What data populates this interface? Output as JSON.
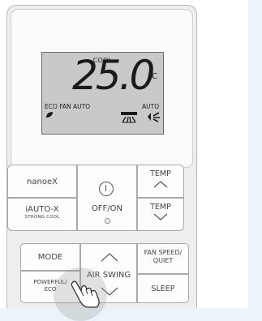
{
  "display": {
    "mode": "COOL",
    "temperature": "25.0",
    "unit": "°C",
    "eco_fan_label": "ECO FAN AUTO",
    "fan_speed_label": "AUTO"
  },
  "buttons": {
    "nanoe": "nanoeX",
    "iauto_line1": "iAUTO-X",
    "iauto_line2": "STRONG COOL",
    "off_on": "OFF/ON",
    "temp_up": "TEMP",
    "temp_down": "TEMP",
    "mode": "MODE",
    "powerful_line1": "POWERFUL/",
    "powerful_line2": "ECO",
    "air_swing": "AIR SWING",
    "fan_speed_line1": "FAN SPEED/",
    "fan_speed_line2": "QUIET",
    "sleep": "SLEEP"
  },
  "icons": {
    "power": "power-icon",
    "leaf": "leaf-icon",
    "louver": "louver-icon",
    "fan": "fan-speed-icon",
    "hand": "pointing-hand-icon"
  },
  "colors": {
    "lcd_bg": "#c9c9c9",
    "page_bg": "#eaf4f9"
  }
}
